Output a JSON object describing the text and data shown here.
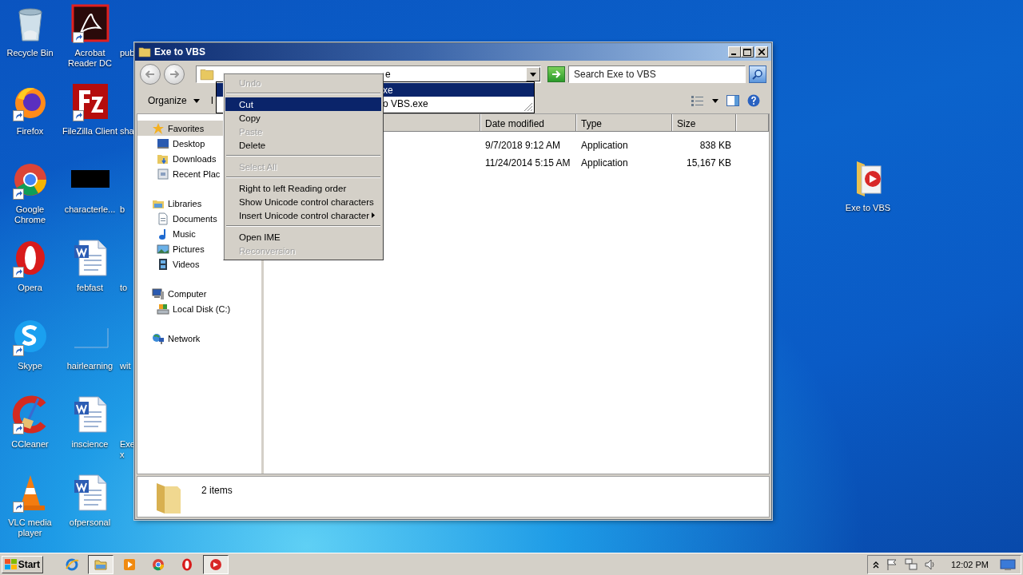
{
  "desktop": {
    "columns": [
      [
        {
          "label": "Recycle Bin",
          "shortcut": false
        },
        {
          "label": "Firefox",
          "shortcut": true
        },
        {
          "label": "Google Chrome",
          "shortcut": true
        },
        {
          "label": "Opera",
          "shortcut": true
        },
        {
          "label": "Skype",
          "shortcut": true
        },
        {
          "label": "CCleaner",
          "shortcut": true
        },
        {
          "label": "VLC media player",
          "shortcut": true
        }
      ],
      [
        {
          "label": "Acrobat Reader DC",
          "shortcut": true
        },
        {
          "label": "FileZilla Client",
          "shortcut": true
        },
        {
          "label": "characterle...",
          "shortcut": false
        },
        {
          "label": "febfast",
          "shortcut": false
        },
        {
          "label": "hairlearning",
          "shortcut": false
        },
        {
          "label": "inscience",
          "shortcut": false
        },
        {
          "label": "ofpersonal",
          "shortcut": false
        }
      ],
      [
        {
          "label": "pub"
        },
        {
          "label": "sha"
        },
        {
          "label": "b"
        },
        {
          "label": "to"
        },
        {
          "label": "wit"
        },
        {
          "label": "Exe\nx"
        }
      ]
    ],
    "right_icon": {
      "label": "Exe to VBS"
    }
  },
  "explorer": {
    "title": "Exe to VBS",
    "address_visible": "e",
    "search": {
      "placeholder": "Search Exe to VBS"
    },
    "toolbar": {
      "organize": "Organize",
      "include": "I"
    },
    "nav": [
      {
        "label": "Favorites",
        "selected": true,
        "children": [
          {
            "label": "Desktop",
            "selected": false
          },
          {
            "label": "Downloads",
            "selected": false
          },
          {
            "label": "Recent Plac",
            "selected": false
          }
        ]
      },
      {
        "label": "Libraries",
        "selected": false,
        "children": [
          {
            "label": "Documents",
            "selected": false
          },
          {
            "label": "Music",
            "selected": false
          },
          {
            "label": "Pictures",
            "selected": false
          },
          {
            "label": "Videos",
            "selected": false
          }
        ]
      },
      {
        "label": "Computer",
        "selected": false,
        "children": [
          {
            "label": "Local Disk (C:)",
            "selected": false
          }
        ]
      },
      {
        "label": "Network",
        "selected": false
      }
    ],
    "columns": [
      "Date modified",
      "Type",
      "Size"
    ],
    "rows": [
      {
        "date_modified": "9/7/2018 9:12 AM",
        "type": "Application",
        "size": "838 KB"
      },
      {
        "date_modified": "11/24/2014 5:15 AM",
        "type": "Application",
        "size": "15,167 KB"
      }
    ],
    "status": "2 items"
  },
  "autocomplete": [
    {
      "text": "xe",
      "selected": true
    },
    {
      "text": "o VBS.exe",
      "selected": false
    }
  ],
  "context_menu": [
    {
      "kind": "item",
      "label": "Undo",
      "disabled": true,
      "selected": false
    },
    {
      "kind": "separator"
    },
    {
      "kind": "item",
      "label": "Cut",
      "disabled": false,
      "selected": true
    },
    {
      "kind": "item",
      "label": "Copy",
      "disabled": false,
      "selected": false
    },
    {
      "kind": "item",
      "label": "Paste",
      "disabled": true,
      "selected": false
    },
    {
      "kind": "item",
      "label": "Delete",
      "disabled": false,
      "selected": false
    },
    {
      "kind": "separator"
    },
    {
      "kind": "item",
      "label": "Select All",
      "disabled": true,
      "selected": false
    },
    {
      "kind": "separator"
    },
    {
      "kind": "item",
      "label": "Right to left Reading order",
      "disabled": false,
      "selected": false
    },
    {
      "kind": "item",
      "label": "Show Unicode control characters",
      "disabled": false,
      "selected": false
    },
    {
      "kind": "item",
      "label": "Insert Unicode control character",
      "disabled": false,
      "selected": false,
      "submenu": true
    },
    {
      "kind": "separator"
    },
    {
      "kind": "item",
      "label": "Open IME",
      "disabled": false,
      "selected": false
    },
    {
      "kind": "item",
      "label": "Reconversion",
      "disabled": true,
      "selected": false
    }
  ],
  "taskbar": {
    "start": "Start",
    "apps": [
      {
        "active": false
      },
      {
        "active": true
      },
      {
        "active": false
      },
      {
        "active": false
      },
      {
        "active": false
      },
      {
        "active": true
      }
    ],
    "clock": "12:02 PM"
  }
}
